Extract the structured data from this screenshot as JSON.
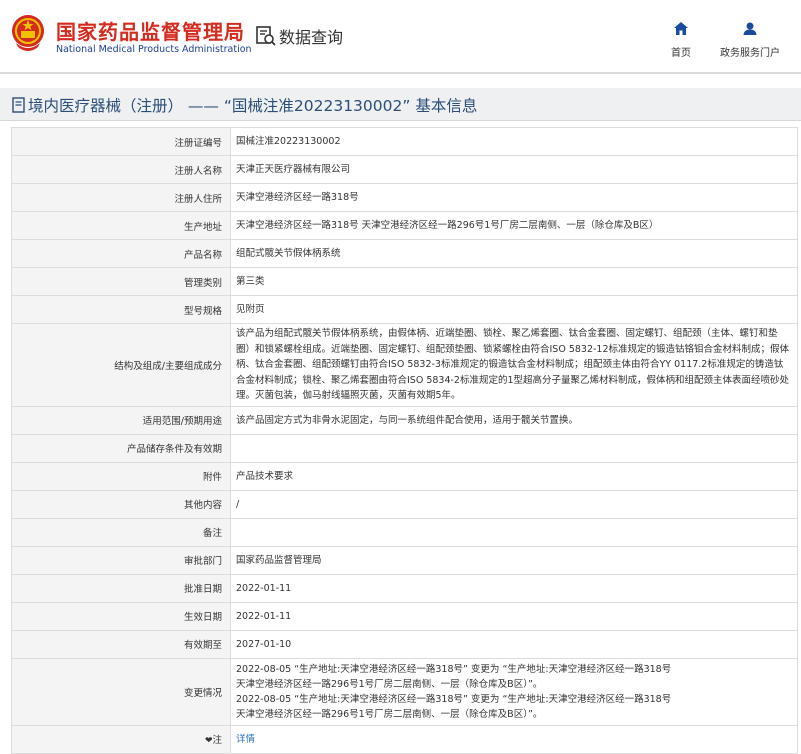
{
  "header": {
    "logo_cn": "国家药品监督管理局",
    "logo_en": "National Medical Products Administration",
    "query_label": "数据查询",
    "nav": [
      {
        "icon": "home-icon",
        "label": "首页"
      },
      {
        "icon": "user-icon",
        "label": "政务服务门户"
      }
    ]
  },
  "title": "境内医疗器械（注册） —— “国械注准20223130002” 基本信息",
  "colors": {
    "brand_red": "#d52b1e",
    "brand_blue": "#1d3f8f",
    "title_blue": "#2b4e77",
    "link_blue": "#2a6fbf",
    "nav_blue": "#1a4b9c"
  },
  "rows": [
    {
      "label": "注册证编号",
      "value": "国械注准20223130002"
    },
    {
      "label": "注册人名称",
      "value": "天津正天医疗器械有限公司"
    },
    {
      "label": "注册人住所",
      "value": "天津空港经济区经一路318号"
    },
    {
      "label": "生产地址",
      "value": "天津空港经济区经一路318号 天津空港经济区经一路296号1号厂房二层南侧、一层（除仓库及B区）"
    },
    {
      "label": "产品名称",
      "value": "组配式髋关节假体柄系统"
    },
    {
      "label": "管理类别",
      "value": "第三类"
    },
    {
      "label": "型号规格",
      "value": "见附页"
    },
    {
      "label": "结构及组成/主要组成成分",
      "value": "该产品为组配式髋关节假体柄系统，由假体柄、近端垫圈、锁栓、聚乙烯套圈、钛合金套圈、固定螺钉、组配颈（主体、螺钉和垫圈）和锁紧螺栓组成。近端垫圈、固定螺钉、组配颈垫圈、锁紧螺栓由符合ISO 5832-12标准规定的锻造钴铬钼合金材料制成；假体柄、钛合金套圈、组配颈螺钉由符合ISO 5832-3标准规定的锻造钛合金材料制成；组配颈主体由符合YY 0117.2标准规定的铸造钛合金材料制成；锁栓、聚乙烯套圈由符合ISO 5834-2标准规定的1型超高分子量聚乙烯材料制成，假体柄和组配颈主体表面经喷砂处理。灭菌包装，伽马射线辐照灭菌，灭菌有效期5年。"
    },
    {
      "label": "适用范围/预期用途",
      "value": "该产品固定方式为非骨水泥固定，与同一系统组件配合使用，适用于髋关节置换。"
    },
    {
      "label": "产品储存条件及有效期",
      "value": ""
    },
    {
      "label": "附件",
      "value": "产品技术要求"
    },
    {
      "label": "其他内容",
      "value": "/"
    },
    {
      "label": "备注",
      "value": ""
    },
    {
      "label": "审批部门",
      "value": "国家药品监督管理局"
    },
    {
      "label": "批准日期",
      "value": "2022-01-11"
    },
    {
      "label": "生效日期",
      "value": "2022-01-11"
    },
    {
      "label": "有效期至",
      "value": "2027-01-10"
    }
  ],
  "change": {
    "label": "变更情况",
    "lines": [
      "2022-08-05 “生产地址:天津空港经济区经一路318号” 变更为 “生产地址:天津空港经济区经一路318号",
      "天津空港经济区经一路296号1号厂房二层南侧、一层（除仓库及B区）”。",
      "2022-08-05 “生产地址:天津空港经济区经一路318号” 变更为 “生产地址:天津空港经济区经一路318号",
      "天津空港经济区经一路296号1号厂房二层南侧、一层（除仓库及B区）”。"
    ]
  },
  "note": {
    "pin": "❤",
    "label": "注",
    "link": "详情"
  }
}
